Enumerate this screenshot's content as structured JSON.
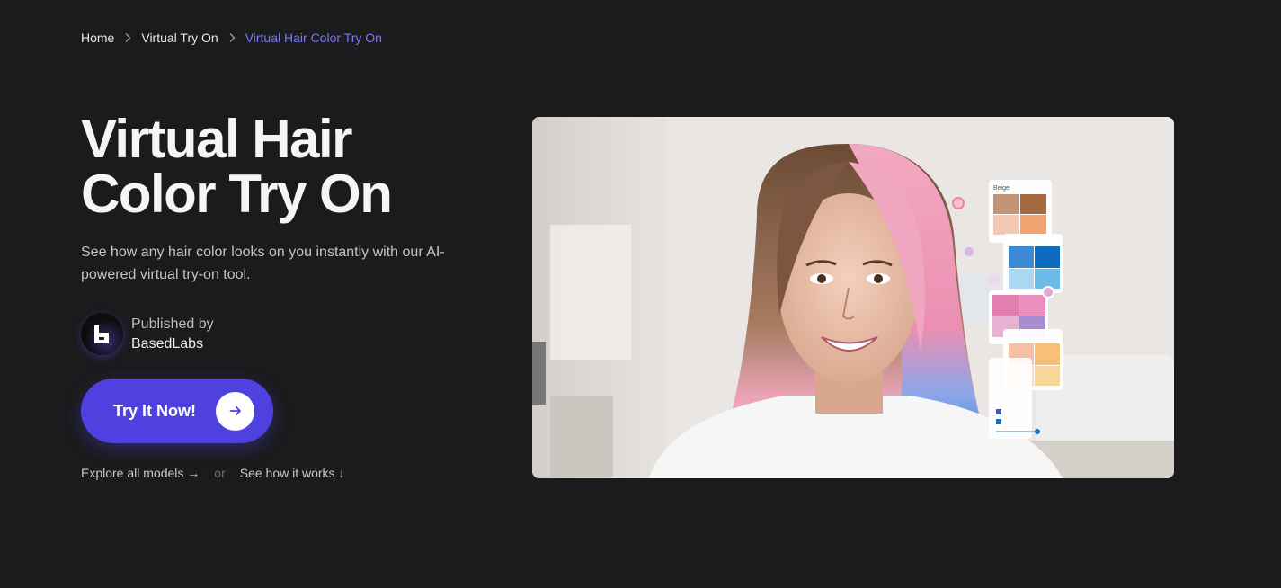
{
  "breadcrumb": {
    "items": [
      {
        "label": "Home"
      },
      {
        "label": "Virtual Try On"
      },
      {
        "label": "Virtual Hair Color Try On"
      }
    ]
  },
  "hero": {
    "title_line1": "Virtual Hair",
    "title_line2": "Color Try On",
    "subtitle": "See how any hair color looks on you instantly with our AI-powered virtual try-on tool.",
    "publisher_label": "Published by",
    "publisher_name": "BasedLabs",
    "cta_label": "Try It Now!",
    "explore_link": "Explore all models →",
    "or_text": "or",
    "how_link": "See how it works ↓"
  },
  "colors": {
    "background": "#1b1b1d",
    "accent": "#4f41e0",
    "breadcrumb_current": "#7b78f0"
  },
  "image": {
    "swatch_panel_title": "Beige"
  }
}
